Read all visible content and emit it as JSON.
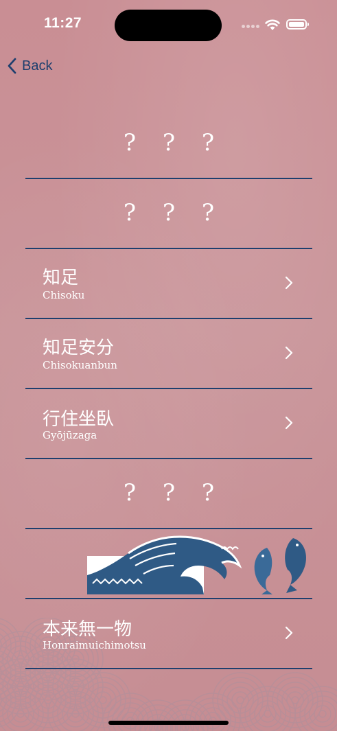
{
  "status_bar": {
    "time": "11:27"
  },
  "nav": {
    "back_label": "Back"
  },
  "sections": [
    {
      "type": "header",
      "text": "? ? ?"
    },
    {
      "type": "header",
      "text": "? ? ?"
    },
    {
      "type": "item",
      "kanji": "知足",
      "romaji": "Chisoku"
    },
    {
      "type": "item",
      "kanji": "知足安分",
      "romaji": "Chisokuanbun"
    },
    {
      "type": "item",
      "kanji": "行住坐臥",
      "romaji": "Gyōjūzaga"
    },
    {
      "type": "header",
      "text": "? ? ?"
    },
    {
      "type": "art",
      "icons": [
        "great-wave-icon",
        "koi-fish-icon"
      ]
    },
    {
      "type": "item",
      "kanji": "本来無一物",
      "romaji": "Honraimuichimotsu"
    }
  ],
  "colors": {
    "background": "#c98e94",
    "divider": "#1e3f6e",
    "text": "#ffffff",
    "accent": "#1e3f6e"
  },
  "icons": {
    "back": "chevron-left-icon",
    "row": "chevron-right-icon",
    "wifi": "wifi-icon",
    "battery": "battery-icon",
    "signal": "cellular-signal-icon"
  }
}
